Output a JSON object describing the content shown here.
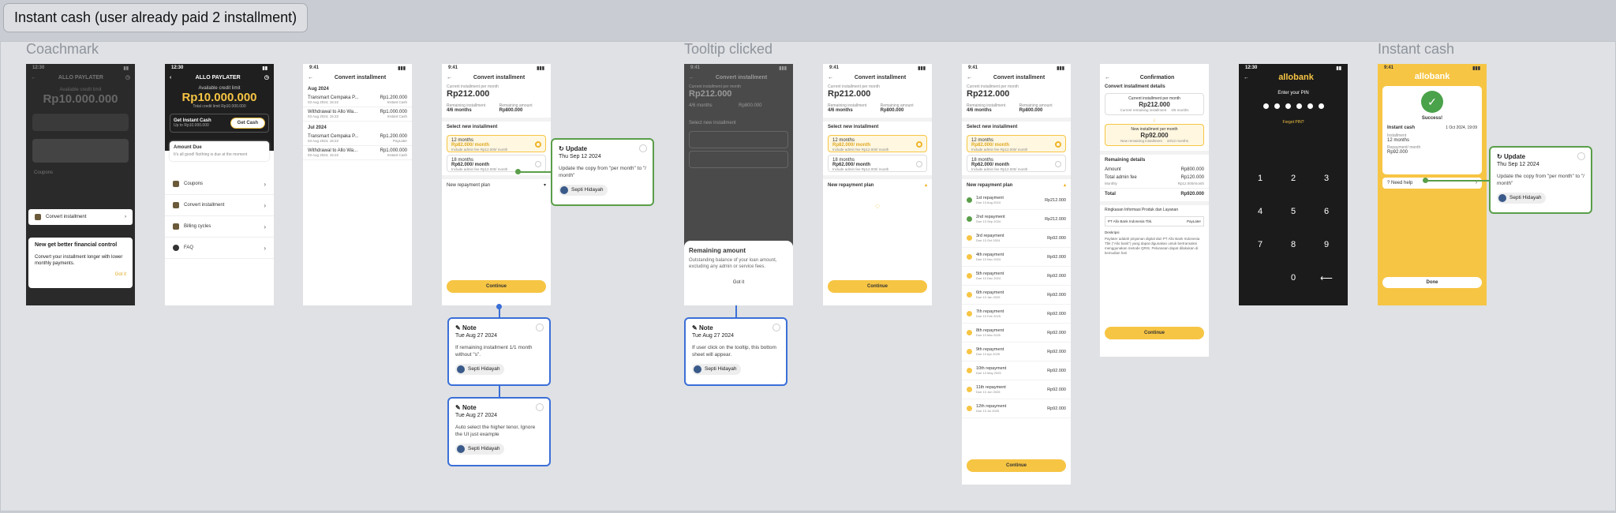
{
  "title": "Instant cash (user already paid 2 installment)",
  "sections": [
    "Coachmark",
    "Tooltip clicked",
    "Instant cash"
  ],
  "s1": {
    "time": "12:30",
    "app": "ALLO PAYLATER",
    "avail": "Available credit limit",
    "limit": "Rp10.000.000",
    "total": "Total credit limit Rp10.000.000",
    "get_cash": "Get Instant Cash",
    "get_cash_sub": "Up to Rp10.000.000",
    "get_btn": "Get Cash",
    "amount_due": "Amount Due",
    "amount_due_sub": "It's all good! Nothing is due at the moment",
    "menu": [
      "Coupons",
      "Convert installment",
      "Billing cycles",
      "FAQ"
    ],
    "coach_title": "New get better financial control",
    "coach_body": "Convert your installment longer with lower monthly payments.",
    "coach_btn": "Got it"
  },
  "s3": {
    "time": "9:41",
    "title": "Convert installment",
    "groups": [
      {
        "month": "Aug 2024",
        "items": [
          {
            "name": "Transmart Cempaka P...",
            "date": "03 Aug 2024, 15:22",
            "amt": "Rp1.200.000",
            "type": "Instant Cash"
          },
          {
            "name": "Withdrawal to Allo Wa...",
            "date": "03 Aug 2024, 15:22",
            "amt": "Rp1.000.000",
            "type": "Instant Cash"
          }
        ]
      },
      {
        "month": "Jul 2024",
        "items": [
          {
            "name": "Transmart Cempaka P...",
            "date": "03 Aug 2024, 15:22",
            "amt": "Rp1.200.000",
            "type": "PayLater"
          },
          {
            "name": "Withdrawal to Allo Wa...",
            "date": "03 Aug 2024, 15:22",
            "amt": "Rp1.000.000",
            "type": "Instant Cash"
          }
        ]
      }
    ]
  },
  "conv": {
    "label": "Current installment per month",
    "amount": "Rp212.000",
    "rem_inst_l": "Remaining installment",
    "rem_inst": "4/6 months",
    "rem_amt_l": "Remaining amount",
    "rem_amt": "Rp800.000",
    "select": "Select new installment",
    "opt1_t": "12 months",
    "opt1_a": "Rp82.000/ month",
    "opt1_s": "Include admin fee Rp12.000/ month",
    "opt2_t": "18 months",
    "opt2_a": "Rp62.000/ month",
    "opt2_s": "Include admin fee Rp12.000/ month",
    "plan": "New repayment plan",
    "continue": "Continue"
  },
  "tooltip": {
    "title": "Remaining amount",
    "body": "Outstanding balance of your loan amount, excluding any admin or service fees.",
    "btn": "Got it"
  },
  "repay": [
    {
      "n": "1st repayment",
      "d": "Due 13 Aug 2024",
      "a": "Rp212.000",
      "p": true
    },
    {
      "n": "2nd repayment",
      "d": "Due 13 Sep 2024",
      "a": "Rp212.000",
      "p": true
    },
    {
      "n": "3rd repayment",
      "d": "Due 13 Oct 2024",
      "a": "Rp92.000",
      "p": false
    },
    {
      "n": "4th repayment",
      "d": "Due 13 Nov 2024",
      "a": "Rp92.000",
      "p": false
    },
    {
      "n": "5th repayment",
      "d": "Due 13 Dec 2024",
      "a": "Rp92.000",
      "p": false
    },
    {
      "n": "6th repayment",
      "d": "Due 13 Jan 2025",
      "a": "Rp92.000",
      "p": false
    },
    {
      "n": "7th repayment",
      "d": "Due 13 Feb 2025",
      "a": "Rp92.000",
      "p": false
    },
    {
      "n": "8th repayment",
      "d": "Due 13 Mar 2025",
      "a": "Rp92.000",
      "p": false
    },
    {
      "n": "9th repayment",
      "d": "Due 13 Apr 2025",
      "a": "Rp92.000",
      "p": false
    },
    {
      "n": "10th repayment",
      "d": "Due 13 May 2025",
      "a": "Rp92.000",
      "p": false
    },
    {
      "n": "11th repayment",
      "d": "Due 13 Jun 2025",
      "a": "Rp92.000",
      "p": false
    },
    {
      "n": "12th repayment",
      "d": "Due 13 Jul 2025",
      "a": "Rp92.000",
      "p": false
    }
  ],
  "confirm": {
    "title": "Confirmation",
    "details": "Convert installment details",
    "cur_l": "Current installment per month",
    "cur": "Rp212.000",
    "cur_s": "Current remaining installment",
    "cur_sv": "4/6 months",
    "new_l": "New installment per month",
    "new": "Rp92.000",
    "new_s": "New remaining installment",
    "new_sv": "10/12 months",
    "rem": "Remaining details",
    "amount_l": "Amount",
    "amount": "Rp800.000",
    "fee_l": "Total admin fee",
    "fee": "Rp120.000",
    "fee_s": "Monthly",
    "fee_sv": "Rp12.000/month",
    "total_l": "Total",
    "total": "Rp920.000",
    "info_t": "Ringkasan Informasi Produk dan Layanan",
    "bank": "PT Allo Bank Indonesia Tbk.",
    "prod": "PayLater",
    "desc_l": "Deskripsi",
    "desc": "Paylater adalah pinjaman digital dari PT Allo Bank Indonesia Tbk (\"Allo bank\") yang dapat digunakan untuk bertransaksi menggunakan metode QRIS. Pelunasan dapat dilakukan di kemudian hari",
    "btn": "Continue"
  },
  "pin": {
    "time": "12:30",
    "brand": "allobank",
    "label": "Enter your PIN",
    "forgot": "Forgot PIN?",
    "keys": [
      "1",
      "2",
      "3",
      "4",
      "5",
      "6",
      "7",
      "8",
      "9",
      "0",
      "⟵"
    ]
  },
  "success": {
    "time": "9:41",
    "brand": "allobank",
    "title": "Success!",
    "ic_l": "Instant cash",
    "ic_v": "1 Oct 2024, 19:09",
    "inst_l": "Installment",
    "inst_v": "12 months",
    "rep_l": "Repayment/ month",
    "rep_v": "Rp92.000",
    "help": "Need help",
    "done": "Done"
  },
  "notes": [
    {
      "h": "Note",
      "d": "Tue Aug 27 2024",
      "b": "If remaining installment 1/1 month without \"s\".",
      "u": "Septi Hidayah"
    },
    {
      "h": "Note",
      "d": "Tue Aug 27 2024",
      "b": "Auto select the higher tenor, Ignore the UI just example",
      "u": "Septi Hidayah"
    },
    {
      "h": "Note",
      "d": "Tue Aug 27 2024",
      "b": "If user click on the tooltip, this bottom sheet will appear.",
      "u": "Septi Hidayah"
    }
  ],
  "updates": [
    {
      "h": "Update",
      "d": "Thu Sep 12 2024",
      "b": "Update the copy from \"per month\" to \"/ month\"",
      "u": "Septi Hidayah"
    },
    {
      "h": "Update",
      "d": "Thu Sep 12 2024",
      "b": "Update the copy from \"per month\" to \"/ month\"",
      "u": "Septi Hidayah"
    }
  ]
}
